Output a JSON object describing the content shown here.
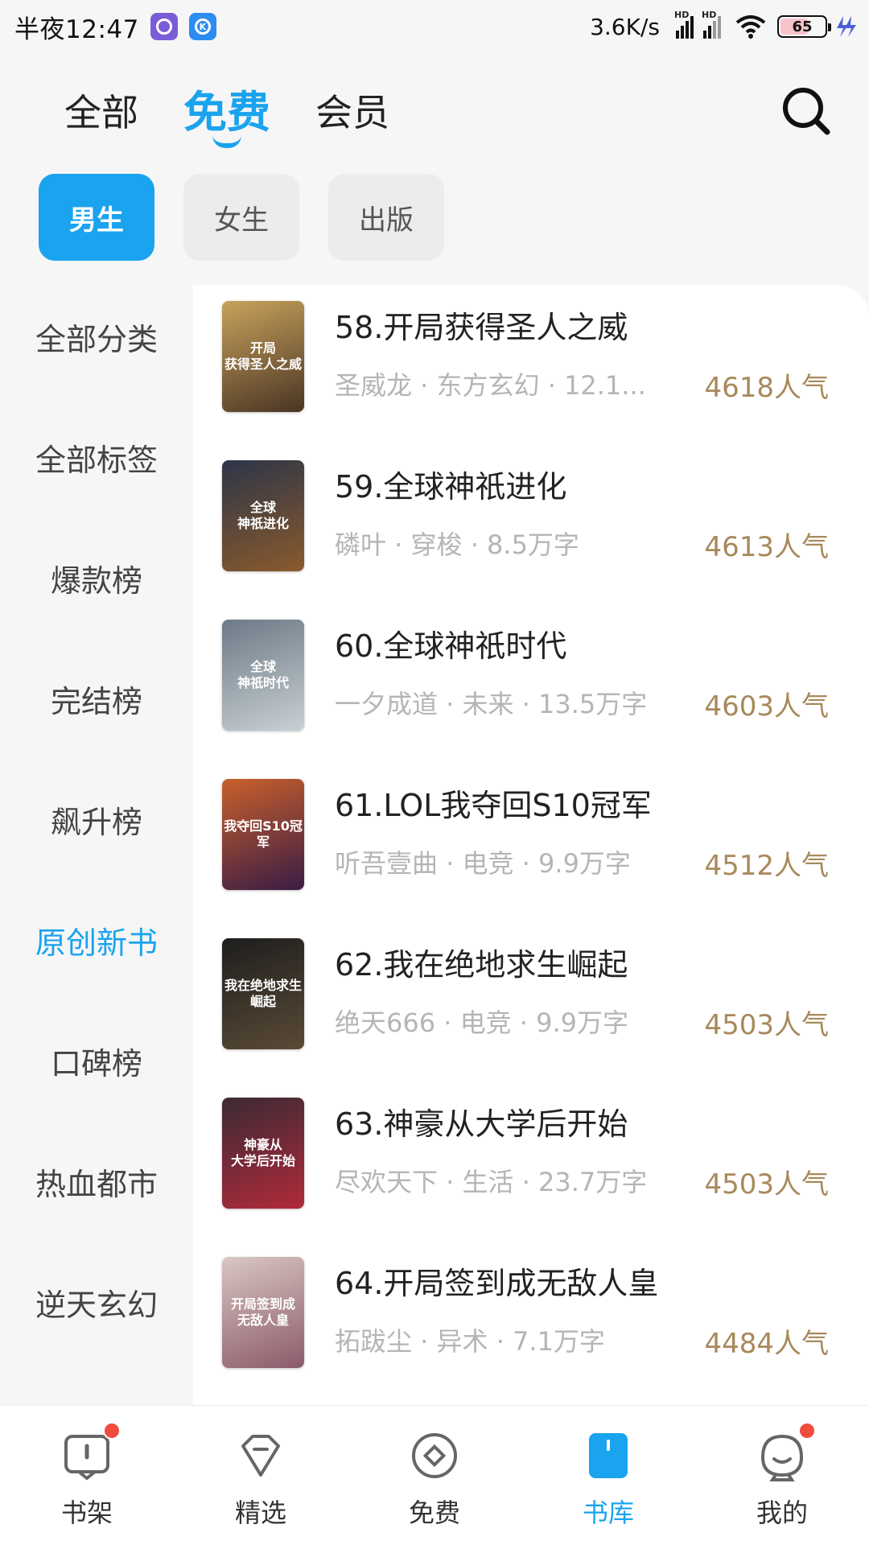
{
  "status_bar": {
    "time": "半夜12:47",
    "net_speed": "3.6K/s",
    "battery": "65",
    "battery_level": 0.65,
    "signal_labels": [
      "HD",
      "HD"
    ]
  },
  "top_tabs": [
    {
      "label": "全部",
      "active": false
    },
    {
      "label": "免费",
      "active": true
    },
    {
      "label": "会员",
      "active": false
    }
  ],
  "chips": [
    {
      "label": "男生",
      "active": true
    },
    {
      "label": "女生",
      "active": false
    },
    {
      "label": "出版",
      "active": false
    }
  ],
  "sidebar": [
    {
      "label": "全部分类",
      "active": false
    },
    {
      "label": "全部标签",
      "active": false
    },
    {
      "label": "爆款榜",
      "active": false
    },
    {
      "label": "完结榜",
      "active": false
    },
    {
      "label": "飙升榜",
      "active": false
    },
    {
      "label": "原创新书",
      "active": true
    },
    {
      "label": "口碑榜",
      "active": false
    },
    {
      "label": "热血都市",
      "active": false
    },
    {
      "label": "逆天玄幻",
      "active": false
    }
  ],
  "books": [
    {
      "title": "58.开局获得圣人之威",
      "meta": "圣威龙 · 东方玄幻 · 12.1...",
      "popularity": "4618人气",
      "cover_text": "开局\n获得圣人之威",
      "cover_colors": [
        "#c8a25c",
        "#4a3524"
      ]
    },
    {
      "title": "59.全球神祇进化",
      "meta": "磷叶 · 穿梭 · 8.5万字",
      "popularity": "4613人气",
      "cover_text": "全球\n神祇进化",
      "cover_colors": [
        "#2d3548",
        "#8a5a2c"
      ]
    },
    {
      "title": "60.全球神祇时代",
      "meta": "一夕成道 · 未来 · 13.5万字",
      "popularity": "4603人气",
      "cover_text": "全球\n神祇时代",
      "cover_colors": [
        "#6c7a86",
        "#c9d0d4"
      ]
    },
    {
      "title": "61.LOL我夺回S10冠军",
      "meta": "听吾壹曲 · 电竞 · 9.9万字",
      "popularity": "4512人气",
      "cover_text": "我夺回S10冠军",
      "cover_colors": [
        "#c8602c",
        "#3a1c44"
      ]
    },
    {
      "title": "62.我在绝地求生崛起",
      "meta": "绝天666 · 电竞 · 9.9万字",
      "popularity": "4503人气",
      "cover_text": "我在绝地求生\n崛起",
      "cover_colors": [
        "#1e1e1e",
        "#5a4a36"
      ]
    },
    {
      "title": "63.神豪从大学后开始",
      "meta": "尽欢天下 · 生活 · 23.7万字",
      "popularity": "4503人气",
      "cover_text": "神豪从\n大学后开始",
      "cover_colors": [
        "#3b2a34",
        "#b02a3a"
      ]
    },
    {
      "title": "64.开局签到成无敌人皇",
      "meta": "拓跋尘 · 异术 · 7.1万字",
      "popularity": "4484人气",
      "cover_text": "开局签到成\n无敌人皇",
      "cover_colors": [
        "#d9c7c2",
        "#8c5a6a"
      ]
    }
  ],
  "bottom_nav": [
    {
      "label": "书架",
      "icon": "bookshelf-icon",
      "active": false,
      "dot": true
    },
    {
      "label": "精选",
      "icon": "diamond-icon",
      "active": false,
      "dot": false
    },
    {
      "label": "免费",
      "icon": "free-icon",
      "active": false,
      "dot": false
    },
    {
      "label": "书库",
      "icon": "library-icon",
      "active": true,
      "dot": false
    },
    {
      "label": "我的",
      "icon": "profile-icon",
      "active": false,
      "dot": true
    }
  ],
  "colors": {
    "accent": "#1aa3ee",
    "popularity": "#a8895b",
    "meta": "#b5b5b5",
    "badge_red": "#f04c3e"
  }
}
